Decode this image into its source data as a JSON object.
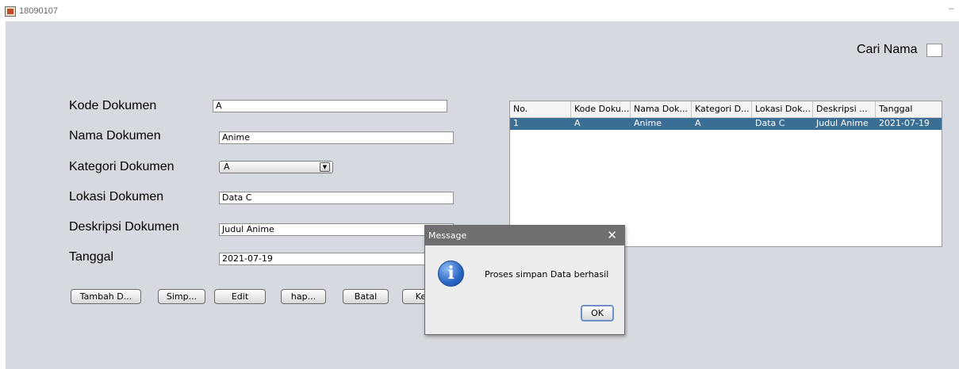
{
  "window": {
    "title": "18090107",
    "minimize": "–"
  },
  "search": {
    "label": "Cari Nama",
    "value": ""
  },
  "form": {
    "kode": {
      "label": "Kode Dokumen",
      "value": "A"
    },
    "nama": {
      "label": "Nama Dokumen",
      "value": "Anime"
    },
    "kategori": {
      "label": "Kategori Dokumen",
      "value": "A"
    },
    "lokasi": {
      "label": "Lokasi Dokumen",
      "value": "Data C"
    },
    "deskripsi": {
      "label": "Deskripsi Dokumen",
      "value": "Judul Anime"
    },
    "tanggal": {
      "label": "Tanggal",
      "value": "2021-07-19"
    }
  },
  "buttons": {
    "tambah": "Tambah D...",
    "simpan": "Simp...",
    "edit": "Edit",
    "hapus": "hap...",
    "batal": "Batal",
    "keluar": "Kel"
  },
  "table": {
    "headers": [
      "No.",
      "Kode Doku...",
      "Nama Dok...",
      "Kategori D...",
      "Lokasi Dok...",
      "Deskripsi ...",
      "Tanggal"
    ],
    "rows": [
      [
        "1",
        "A",
        "Anime",
        "A",
        "Data C",
        "Judul Anime",
        "2021-07-19"
      ]
    ],
    "selected_color": "#3b6e94"
  },
  "dialog": {
    "title": "Message",
    "close": "✕",
    "icon": "info-icon",
    "message": "Proses simpan Data berhasil",
    "ok": "OK"
  }
}
